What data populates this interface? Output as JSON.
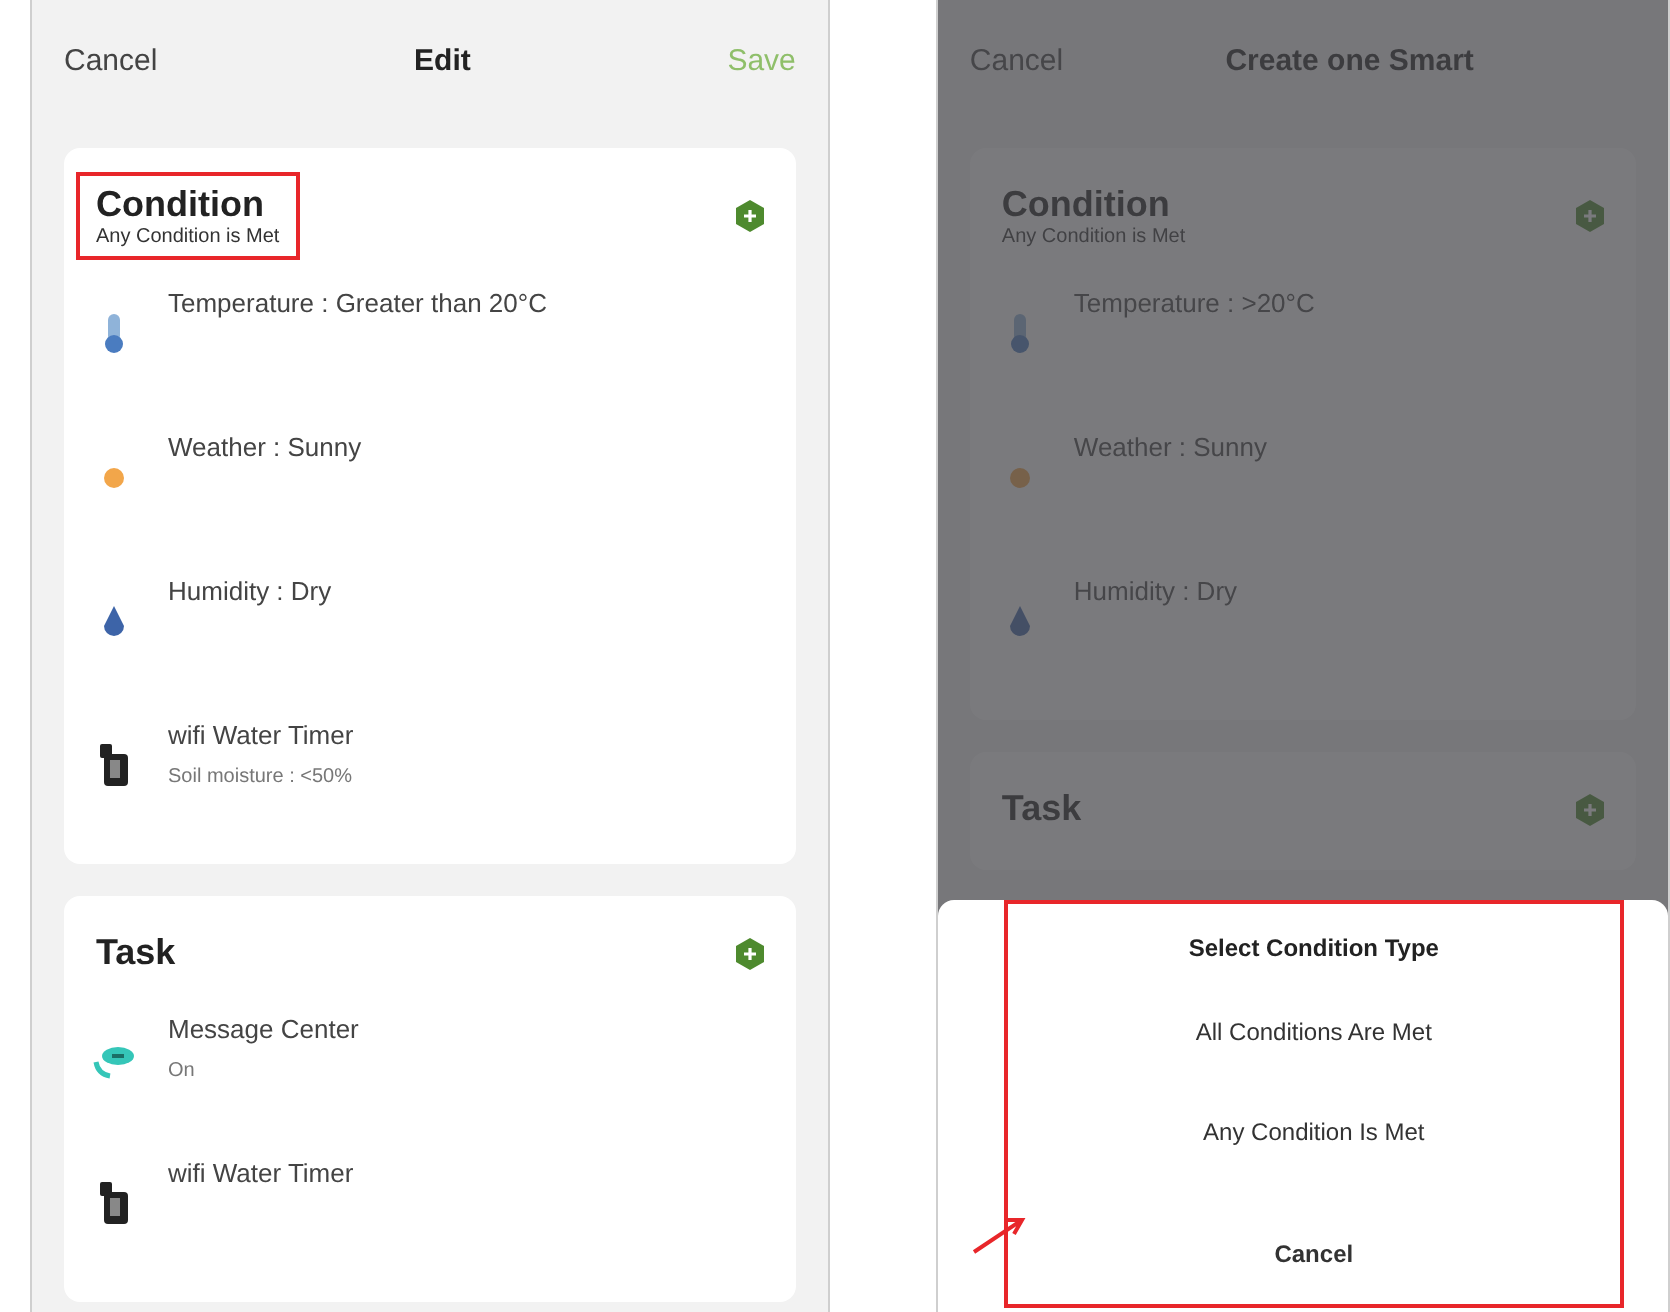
{
  "screens": [
    {
      "dimmed": false,
      "nav": {
        "left": "Cancel",
        "title": "Edit",
        "right": "Save"
      },
      "sections": [
        {
          "title": "Condition",
          "subtitle": "Any Condition is Met",
          "highlighted": true,
          "rows": [
            {
              "kind": "temperature",
              "title": "Temperature : Greater than 20°C"
            },
            {
              "kind": "weather",
              "title": "Weather : Sunny"
            },
            {
              "kind": "humidity",
              "title": "Humidity : Dry"
            },
            {
              "kind": "device",
              "title": "wifi Water Timer",
              "subtitle": "Soil moisture : <50%"
            }
          ]
        },
        {
          "title": "Task",
          "highlighted": false,
          "rows": [
            {
              "kind": "message",
              "title": "Message Center",
              "subtitle": "On"
            },
            {
              "kind": "device",
              "title": "wifi Water Timer"
            }
          ]
        }
      ]
    },
    {
      "dimmed": true,
      "nav": {
        "left": "Cancel",
        "title": "Create one Smart"
      },
      "sections": [
        {
          "title": "Condition",
          "subtitle": "Any Condition is Met",
          "highlighted": false,
          "rows": [
            {
              "kind": "temperature",
              "title": "Temperature : >20°C"
            },
            {
              "kind": "weather",
              "title": "Weather : Sunny"
            },
            {
              "kind": "humidity",
              "title": "Humidity : Dry"
            }
          ]
        },
        {
          "title": "Task",
          "highlighted": false
        }
      ],
      "sheet": {
        "title": "Select Condition Type",
        "options": [
          "All Conditions Are Met",
          "Any Condition Is Met"
        ],
        "cancel": "Cancel",
        "highlighted": true
      }
    }
  ]
}
